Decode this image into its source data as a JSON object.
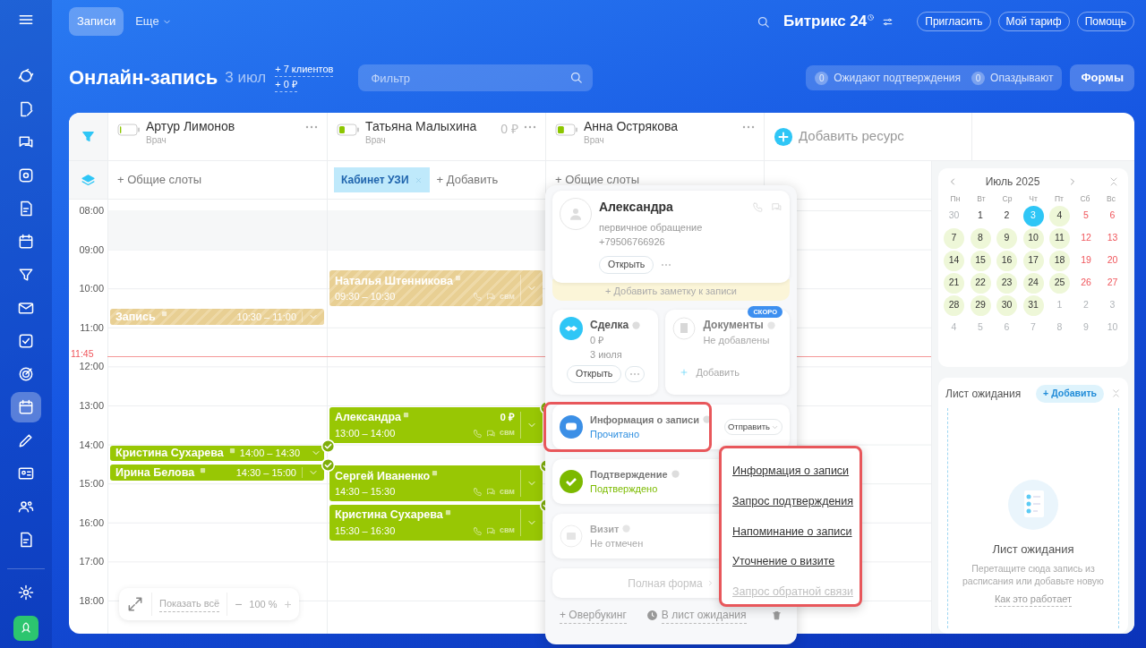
{
  "sidebar": {
    "items": [
      {
        "selected": false
      },
      {
        "selected": false
      },
      {
        "selected": false
      },
      {
        "selected": false
      },
      {
        "selected": false
      },
      {
        "selected": false
      },
      {
        "selected": false
      },
      {
        "selected": false
      },
      {
        "selected": false
      },
      {
        "selected": false
      },
      {
        "selected": true
      },
      {
        "selected": false
      },
      {
        "selected": false
      },
      {
        "selected": false
      },
      {
        "selected": false
      }
    ]
  },
  "topbar": {
    "tabs": [
      {
        "label": "Записи",
        "selected": true,
        "dropdown": false
      },
      {
        "label": "Еще",
        "selected": false,
        "dropdown": true
      }
    ],
    "brand": "Битрикс 24",
    "buttons": [
      "Пригласить",
      "Мой тариф",
      "Помощь"
    ]
  },
  "header": {
    "title": "Онлайн-запись",
    "date": "3 июл",
    "stats": [
      "+ 7 клиентов",
      "+ 0 ₽"
    ],
    "filter": {
      "placeholder": "Фильтр"
    },
    "counters": [
      {
        "count": "0",
        "label": "Ожидают подтверждения"
      },
      {
        "count": "0",
        "label": "Опаздывают"
      }
    ],
    "forms_button": "Формы"
  },
  "resources": [
    {
      "name": "Артур Лимонов",
      "role": "Врач",
      "level": 0.08,
      "slot_action": "+ Общие слоты",
      "events": [
        {
          "kind": "compact",
          "name": "Запись",
          "time": "10:30 – 11:00",
          "confirmed": false
        },
        {
          "kind": "compact",
          "name": "Кристина Сухарева",
          "time": "14:00 – 14:30",
          "confirmed": true
        },
        {
          "kind": "compact",
          "name": "Ирина Белова",
          "time": "14:30 – 15:00",
          "confirmed": true
        }
      ]
    },
    {
      "name": "Татьяна Малыхина",
      "role": "Врач",
      "level": 0.35,
      "amount": "0 ₽",
      "slot_tag": "Кабинет УЗИ",
      "slot_action": "+ Добавить",
      "events": [
        {
          "kind": "full",
          "name": "Наталья Штенникова",
          "time": "09:30 – 10:30",
          "confirmed": false,
          "tag": "свм"
        },
        {
          "kind": "full",
          "name": "Александра",
          "time": "13:00 – 14:00",
          "amount": "0 ₽",
          "confirmed": true,
          "tag": "свм"
        },
        {
          "kind": "full",
          "name": "Сергей Иваненко",
          "time": "14:30 – 15:30",
          "confirmed": true,
          "tag": "свм"
        },
        {
          "kind": "full",
          "name": "Кристина Сухарева",
          "time": "15:30 – 16:30",
          "confirmed": true,
          "tag": "свм"
        }
      ]
    },
    {
      "name": "Анна Острякова",
      "role": "Врач",
      "level": 0.4,
      "slot_action": "+ Общие слоты"
    }
  ],
  "add_resource": "Добавить ресурс",
  "hours": [
    "08:00",
    "09:00",
    "10:00",
    "11:00",
    "12:00",
    "13:00",
    "14:00",
    "15:00",
    "16:00",
    "17:00",
    "18:00"
  ],
  "now": "11:45",
  "zoom_control": {
    "show_all": "Показать всё",
    "minus": "−",
    "zoom": "100 %",
    "plus": "+"
  },
  "calendar": {
    "title": "Июль 2025",
    "weekdays": [
      "Пн",
      "Вт",
      "Ср",
      "Чт",
      "Пт",
      "Сб",
      "Вс"
    ],
    "weeks": [
      [
        {
          "day": "30",
          "kind": "outside"
        },
        {
          "day": "1",
          "kind": "day"
        },
        {
          "day": "2",
          "kind": "day"
        },
        {
          "day": "3",
          "kind": "today"
        },
        {
          "day": "4",
          "kind": "booked"
        },
        {
          "day": "5",
          "kind": "weekend"
        },
        {
          "day": "6",
          "kind": "weekend"
        }
      ],
      [
        {
          "day": "7",
          "kind": "booked"
        },
        {
          "day": "8",
          "kind": "booked"
        },
        {
          "day": "9",
          "kind": "booked"
        },
        {
          "day": "10",
          "kind": "booked"
        },
        {
          "day": "11",
          "kind": "booked"
        },
        {
          "day": "12",
          "kind": "weekend"
        },
        {
          "day": "13",
          "kind": "weekend"
        }
      ],
      [
        {
          "day": "14",
          "kind": "booked"
        },
        {
          "day": "15",
          "kind": "booked"
        },
        {
          "day": "16",
          "kind": "booked"
        },
        {
          "day": "17",
          "kind": "booked"
        },
        {
          "day": "18",
          "kind": "booked"
        },
        {
          "day": "19",
          "kind": "weekend"
        },
        {
          "day": "20",
          "kind": "weekend"
        }
      ],
      [
        {
          "day": "21",
          "kind": "booked"
        },
        {
          "day": "22",
          "kind": "booked"
        },
        {
          "day": "23",
          "kind": "booked"
        },
        {
          "day": "24",
          "kind": "booked"
        },
        {
          "day": "25",
          "kind": "booked"
        },
        {
          "day": "26",
          "kind": "weekend"
        },
        {
          "day": "27",
          "kind": "weekend"
        }
      ],
      [
        {
          "day": "28",
          "kind": "booked"
        },
        {
          "day": "29",
          "kind": "booked"
        },
        {
          "day": "30",
          "kind": "booked"
        },
        {
          "day": "31",
          "kind": "booked"
        },
        {
          "day": "1",
          "kind": "outside"
        },
        {
          "day": "2",
          "kind": "outside"
        },
        {
          "day": "3",
          "kind": "outside"
        }
      ],
      [
        {
          "day": "4",
          "kind": "outside"
        },
        {
          "day": "5",
          "kind": "outside"
        },
        {
          "day": "6",
          "kind": "outside"
        },
        {
          "day": "7",
          "kind": "outside"
        },
        {
          "day": "8",
          "kind": "outside"
        },
        {
          "day": "9",
          "kind": "outside"
        },
        {
          "day": "10",
          "kind": "outside"
        }
      ]
    ]
  },
  "waitlist": {
    "title": "Лист ожидания",
    "add": "+ Добавить",
    "empty_title": "Лист ожидания",
    "empty_text": "Перетащите сюда запись из расписания или добавьте новую",
    "link": "Как это работает"
  },
  "popup": {
    "client": {
      "name": "Александра",
      "note": "первичное обращение",
      "phone": "+79506766926",
      "open": "Открыть"
    },
    "add_note": "+ Добавить заметку к записи",
    "deal": {
      "title": "Сделка",
      "amount": "0 ₽",
      "date": "3 июля",
      "open": "Открыть"
    },
    "documents": {
      "title": "Документы",
      "badge": "СКОРО",
      "status": "Не добавлены",
      "add": "Добавить",
      "disabled": true
    },
    "steps": [
      {
        "kind": "message",
        "title": "Информация о записи",
        "status": "Прочитано",
        "highlighted": true,
        "action": "Отправить"
      },
      {
        "kind": "confirm",
        "title": "Подтверждение",
        "status": "Подтверждено",
        "highlighted": false
      },
      {
        "kind": "visit",
        "title": "Визит",
        "status": "Не отмечен",
        "highlighted": false
      }
    ],
    "full_form": "Полная форма",
    "overbooking": "+ Овербукинг",
    "to_waitlist": "В лист ожидания"
  },
  "send_menu": {
    "highlighted": true,
    "items": [
      {
        "label": "Информация о записи",
        "disabled": false
      },
      {
        "label": "Запрос подтверждения",
        "disabled": false
      },
      {
        "label": "Напоминание о записи",
        "disabled": false
      },
      {
        "label": "Уточнение о визите",
        "disabled": false
      },
      {
        "label": "Запрос обратной связи",
        "disabled": true
      }
    ]
  }
}
